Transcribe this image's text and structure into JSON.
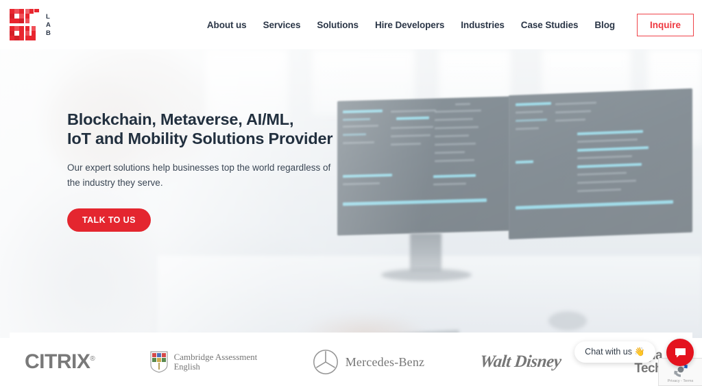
{
  "brand": {
    "logo_primary": "SOLU",
    "logo_secondary": "LAB",
    "logo_letters": [
      "L",
      "A",
      "B"
    ],
    "accent_red": "#e4262f",
    "logo_navy": "#2b3647"
  },
  "nav": {
    "items": [
      {
        "label": "About us",
        "name": "nav-item-about-us"
      },
      {
        "label": "Services",
        "name": "nav-item-services"
      },
      {
        "label": "Solutions",
        "name": "nav-item-solutions"
      },
      {
        "label": "Hire Developers",
        "name": "nav-item-hire-developers"
      },
      {
        "label": "Industries",
        "name": "nav-item-industries"
      },
      {
        "label": "Case Studies",
        "name": "nav-item-case-studies"
      },
      {
        "label": "Blog",
        "name": "nav-item-blog"
      }
    ],
    "inquire_label": "Inquire"
  },
  "hero": {
    "title": "Blockchain, Metaverse, AI/ML,\nIoT and Mobility Solutions Provider",
    "subtitle": "Our expert solutions help businesses top the world regardless of the industry they serve.",
    "cta_label": "TALK TO US"
  },
  "clients": {
    "citrix": {
      "name": "CITRIX",
      "registered": "®"
    },
    "cambridge": {
      "line1": "Cambridge Assessment",
      "line2": "English"
    },
    "mercedes": {
      "name": "Mercedes-Benz"
    },
    "disney": {
      "name": "Walt Disney"
    },
    "georgia_tech": {
      "line1": "Georgia",
      "line2": "Tech"
    }
  },
  "chat": {
    "bubble_text": "Chat with us 👋",
    "button_icon": "chat-bubble-icon"
  },
  "recaptcha": {
    "privacy_terms": "Privacy - Terms"
  }
}
